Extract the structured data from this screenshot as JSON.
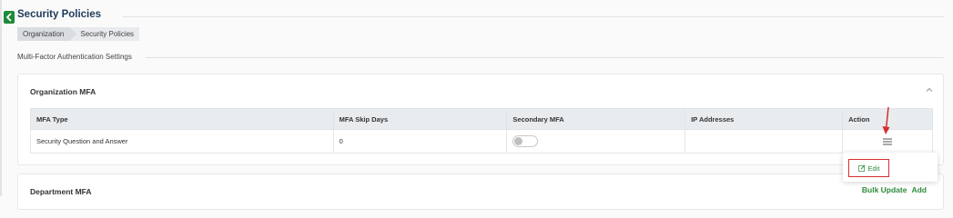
{
  "page": {
    "title": "Security Policies"
  },
  "breadcrumb": {
    "items": [
      "Organization",
      "Security Policies"
    ]
  },
  "section": {
    "label": "Multi-Factor Authentication Settings"
  },
  "org_card": {
    "title": "Organization MFA",
    "table": {
      "columns": [
        "MFA Type",
        "MFA Skip Days",
        "Secondary MFA",
        "IP Addresses",
        "Action"
      ],
      "rows": [
        {
          "mfa_type": "Security Question and Answer",
          "skip_days": "0",
          "secondary_mfa_enabled": false,
          "ip_addresses": ""
        }
      ]
    },
    "action_menu": {
      "items": [
        "Edit"
      ]
    }
  },
  "dept_card": {
    "title": "Department MFA",
    "actions": [
      "Bulk Update",
      "Add"
    ]
  },
  "colors": {
    "accent_green": "#2e8b3d",
    "title_blue": "#1f3a5a",
    "highlight_red": "#d32f2f"
  }
}
